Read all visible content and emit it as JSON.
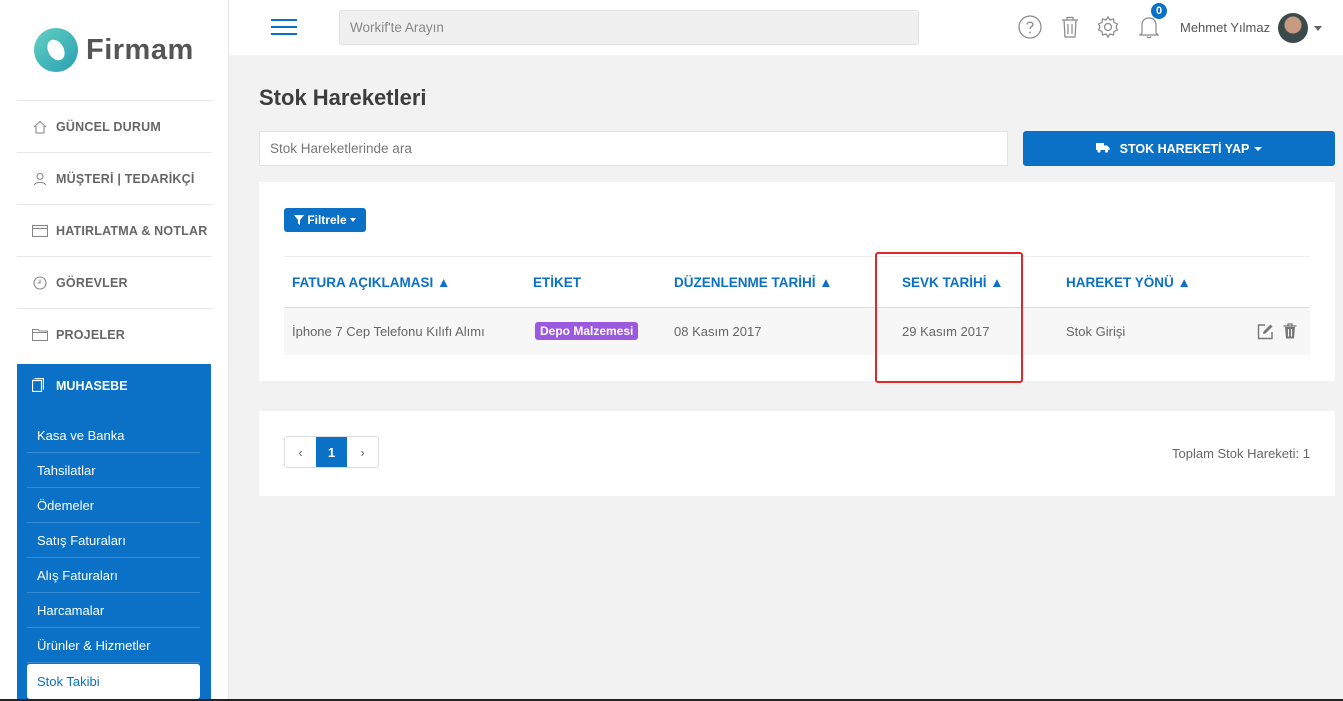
{
  "brand": {
    "name": "Firmam"
  },
  "sidebar": {
    "items": [
      {
        "label": "GÜNCEL DURUM",
        "icon": "home-icon"
      },
      {
        "label": "MÜŞTERİ | TEDARİKÇİ",
        "icon": "user-icon"
      },
      {
        "label": "HATIRLATMA & NOTLAR",
        "icon": "calendar-icon"
      },
      {
        "label": "GÖREVLER",
        "icon": "clock-icon"
      },
      {
        "label": "PROJELER",
        "icon": "folder-icon"
      }
    ],
    "section": {
      "label": "MUHASEBE",
      "icon": "document-icon",
      "items": [
        "Kasa ve Banka",
        "Tahsilatlar",
        "Ödemeler",
        "Satış Faturaları",
        "Alış Faturaları",
        "Harcamalar",
        "Ürünler & Hizmetler",
        "Stok Takibi"
      ],
      "active": "Stok Takibi"
    }
  },
  "header": {
    "search_placeholder": "Workif'te Arayın",
    "notification_count": "0",
    "user_name": "Mehmet Yılmaz"
  },
  "page": {
    "title": "Stok Hareketleri",
    "search_placeholder": "Stok Hareketlerinde ara",
    "action_button": "STOK HAREKETİ YAP",
    "filter_button": "Filtrele"
  },
  "table": {
    "columns": [
      "FATURA AÇIKLAMASI ▲",
      "ETİKET",
      "DÜZENLENME TARİHİ ▲",
      "SEVK TARİHİ ▲",
      "HAREKET YÖNÜ ▲"
    ],
    "rows": [
      {
        "description": "İphone 7 Cep Telefonu Kılıfı Alımı",
        "tag": "Depo Malzemesi",
        "edit_date": "08 Kasım 2017",
        "ship_date": "29 Kasım 2017",
        "direction": "Stok Girişi"
      }
    ]
  },
  "pagination": {
    "prev": "‹",
    "current": "1",
    "next": "›"
  },
  "footer": {
    "total": "Toplam Stok Hareketi: 1"
  },
  "colors": {
    "primary": "#0a71c6",
    "tag": "#9b59e0",
    "highlight": "#e0272a"
  }
}
